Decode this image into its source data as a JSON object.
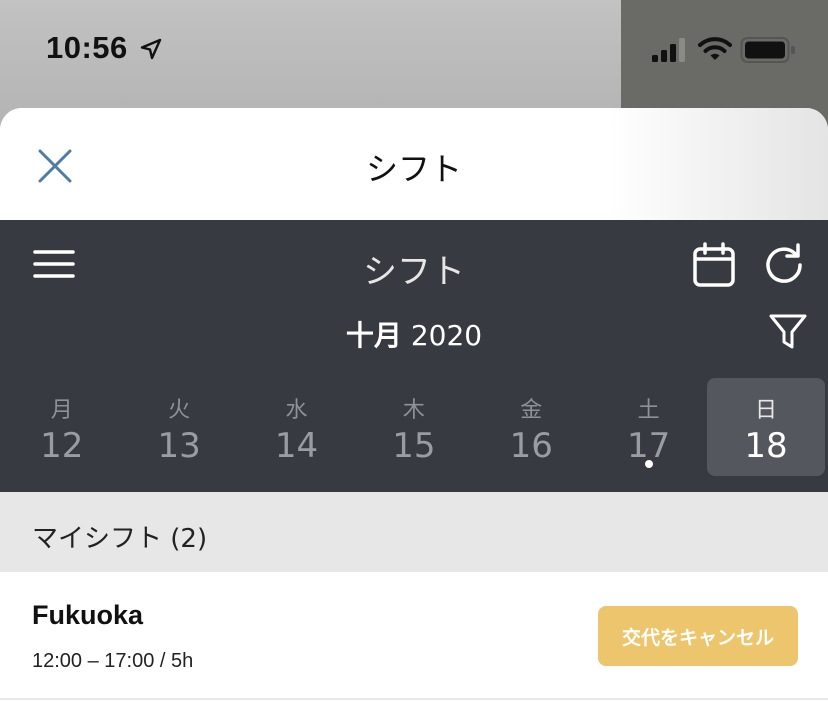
{
  "status_bar": {
    "time": "10:56"
  },
  "sheet": {
    "title": "シフト",
    "close_icon": "close-icon"
  },
  "nav": {
    "title": "シフト",
    "month": "十月",
    "year": "2020",
    "icons": [
      "menu-icon",
      "calendar-icon",
      "refresh-icon",
      "filter-icon"
    ]
  },
  "week": {
    "days": [
      {
        "weekday": "月",
        "date": "12",
        "selected": false,
        "has_event": false
      },
      {
        "weekday": "火",
        "date": "13",
        "selected": false,
        "has_event": false
      },
      {
        "weekday": "水",
        "date": "14",
        "selected": false,
        "has_event": false
      },
      {
        "weekday": "木",
        "date": "15",
        "selected": false,
        "has_event": false
      },
      {
        "weekday": "金",
        "date": "16",
        "selected": false,
        "has_event": false
      },
      {
        "weekday": "土",
        "date": "17",
        "selected": false,
        "has_event": true
      },
      {
        "weekday": "日",
        "date": "18",
        "selected": true,
        "has_event": false
      }
    ]
  },
  "section": {
    "title": "マイシフト (2)"
  },
  "shifts": [
    {
      "name": "Fukuoka",
      "time": "12:00 – 17:00 / 5h",
      "action_label": "交代をキャンセル"
    }
  ],
  "colors": {
    "nav_background": "#383a41",
    "selected_day": "#54575e",
    "action_button": "#ecc56c",
    "close_icon": "#4f7ba8"
  }
}
